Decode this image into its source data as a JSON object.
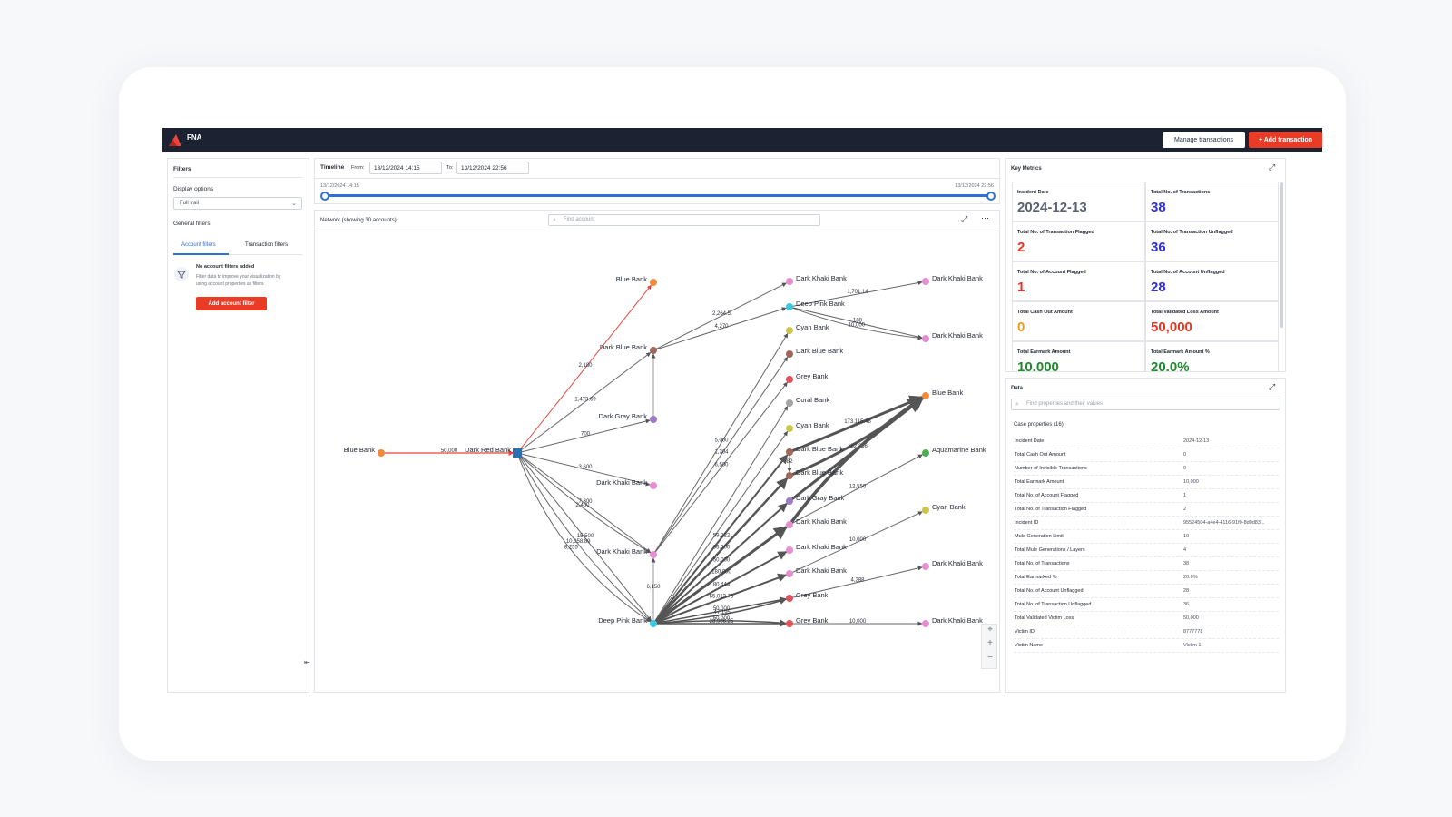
{
  "app": {
    "title": "FNA"
  },
  "header": {
    "manage_label": "Manage transactions",
    "add_label": "+ Add transaction"
  },
  "filters": {
    "title": "Filters",
    "display_options_label": "Display options",
    "display_option_value": "Full trail",
    "general_filters_label": "General filters",
    "tabs": [
      "Account filters",
      "Transaction filters"
    ],
    "empty_title": "No account filters added",
    "empty_text_1": "Filter data to improve your visualization by",
    "empty_text_2": "using account properties as filters",
    "add_filter_label": "Add account filter"
  },
  "timeline": {
    "title": "Timeline",
    "from_label": "From:",
    "from_value": "13/12/2024 14:15",
    "to_label": "To:",
    "to_value": "13/12/2024 22:56",
    "range_start": "13/12/2024 14:15",
    "range_end": "13/12/2024 22:56"
  },
  "network": {
    "title": "Network (showing 30 accounts)",
    "search_placeholder": "Find account",
    "nodes": [
      {
        "id": "n1",
        "label": "Blue Bank",
        "color": "#f08a3c"
      },
      {
        "id": "n2",
        "label": "Dark Red Bank",
        "color": "#2f6fb0"
      },
      {
        "id": "n3",
        "label": "Blue Bank",
        "color": "#f08a3c"
      },
      {
        "id": "n4",
        "label": "Dark Blue Bank",
        "color": "#a0675c"
      },
      {
        "id": "n5",
        "label": "Dark Gray Bank",
        "color": "#9a7cc6"
      },
      {
        "id": "n6",
        "label": "Dark Khaki Bank",
        "color": "#e58fd0"
      },
      {
        "id": "n7",
        "label": "Dark Khaki Bank",
        "color": "#e58fd0"
      },
      {
        "id": "n8",
        "label": "Deep Pink Bank",
        "color": "#3cc7e0"
      },
      {
        "id": "n9",
        "label": "Dark Khaki Bank",
        "color": "#e58fd0"
      },
      {
        "id": "n10",
        "label": "Deep Pink Bank",
        "color": "#3cc7e0"
      },
      {
        "id": "n11",
        "label": "Cyan Bank",
        "color": "#c9c64a"
      },
      {
        "id": "n12",
        "label": "Dark Blue Bank",
        "color": "#a0675c"
      },
      {
        "id": "n13",
        "label": "Grey Bank",
        "color": "#e0525a"
      },
      {
        "id": "n14",
        "label": "Coral Bank",
        "color": "#a3a3a3"
      },
      {
        "id": "n15",
        "label": "Cyan Bank",
        "color": "#c9c64a"
      },
      {
        "id": "n16",
        "label": "Dark Blue Bank",
        "color": "#a0675c"
      },
      {
        "id": "n17",
        "label": "Dark Blue Bank",
        "color": "#a0675c"
      },
      {
        "id": "n18",
        "label": "Dark Gray Bank",
        "color": "#9a7cc6"
      },
      {
        "id": "n19",
        "label": "Dark Khaki Bank",
        "color": "#e58fd0"
      },
      {
        "id": "n20",
        "label": "Dark Khaki Bank",
        "color": "#e58fd0"
      },
      {
        "id": "n21",
        "label": "Dark Khaki Bank",
        "color": "#e58fd0"
      },
      {
        "id": "n22",
        "label": "Grey Bank",
        "color": "#e0525a"
      },
      {
        "id": "n23",
        "label": "Grey Bank",
        "color": "#e0525a"
      },
      {
        "id": "n24",
        "label": "Dark Khaki Bank",
        "color": "#e58fd0"
      },
      {
        "id": "n25",
        "label": "Dark Khaki Bank",
        "color": "#e58fd0"
      },
      {
        "id": "n26",
        "label": "Blue Bank",
        "color": "#f08a3c"
      },
      {
        "id": "n27",
        "label": "Aquamarine Bank",
        "color": "#4caf50"
      },
      {
        "id": "n28",
        "label": "Cyan Bank",
        "color": "#c9c64a"
      },
      {
        "id": "n29",
        "label": "Dark Khaki Bank",
        "color": "#e58fd0"
      },
      {
        "id": "n30",
        "label": "Dark Khaki Bank",
        "color": "#e58fd0"
      }
    ],
    "edges": [
      {
        "from": "n1",
        "to": "n2",
        "label": "50,000",
        "w": 1.2,
        "color": "#e8453c"
      },
      {
        "from": "n2",
        "to": "n3",
        "label": "2,180",
        "w": 1,
        "color": "#e8453c"
      },
      {
        "from": "n2",
        "to": "n4",
        "label": "1,473.69",
        "w": 1,
        "color": "#666"
      },
      {
        "from": "n2",
        "to": "n5",
        "label": "700",
        "w": 1,
        "color": "#666"
      },
      {
        "from": "n2",
        "to": "n6",
        "label": "3,600",
        "w": 1,
        "color": "#666"
      },
      {
        "from": "n2",
        "to": "n7",
        "label": "7,300",
        "w": 1,
        "color": "#666"
      },
      {
        "from": "n2",
        "to": "n7",
        "label": "2,400",
        "w": 1,
        "color": "#666",
        "curve": 10
      },
      {
        "from": "n2",
        "to": "n8",
        "label": "15,500",
        "w": 1,
        "color": "#666"
      },
      {
        "from": "n2",
        "to": "n8",
        "label": "10,058.89",
        "w": 1,
        "color": "#666",
        "curve": 20
      },
      {
        "from": "n2",
        "to": "n8",
        "label": "8,255",
        "w": 1,
        "color": "#666",
        "curve": 40
      },
      {
        "from": "n4",
        "to": "n9",
        "label": "2,264.5",
        "w": 1,
        "color": "#666"
      },
      {
        "from": "n4",
        "to": "n10",
        "label": "4,270",
        "w": 1,
        "color": "#666"
      },
      {
        "from": "n10",
        "to": "n29",
        "label": "1,701.14",
        "w": 1,
        "color": "#666"
      },
      {
        "from": "n10",
        "to": "n30",
        "label": "188",
        "w": 1,
        "color": "#666"
      },
      {
        "from": "n10",
        "to": "n30",
        "label": "10,000",
        "w": 1,
        "color": "#666",
        "curve": 10
      },
      {
        "from": "n5",
        "to": "n4",
        "label": "",
        "w": 1,
        "color": "#999"
      },
      {
        "from": "n8",
        "to": "n7",
        "label": "6,150",
        "w": 1,
        "color": "#999"
      },
      {
        "from": "n7",
        "to": "n12",
        "label": "1,304",
        "w": 1,
        "color": "#666"
      },
      {
        "from": "n7",
        "to": "n11",
        "label": "5,000",
        "w": 1,
        "color": "#666"
      },
      {
        "from": "n7",
        "to": "n13",
        "label": "6,500",
        "w": 1,
        "color": "#666"
      },
      {
        "from": "n8",
        "to": "n14",
        "label": "",
        "w": 1,
        "color": "#666"
      },
      {
        "from": "n8",
        "to": "n15",
        "label": "",
        "w": 1,
        "color": "#666"
      },
      {
        "from": "n8",
        "to": "n16",
        "label": "59,222",
        "w": 2,
        "color": "#555"
      },
      {
        "from": "n8",
        "to": "n17",
        "label": "96,000",
        "w": 2.5,
        "color": "#555"
      },
      {
        "from": "n8",
        "to": "n18",
        "label": "50,000",
        "w": 2,
        "color": "#555"
      },
      {
        "from": "n8",
        "to": "n19",
        "label": "180,000",
        "w": 3,
        "color": "#555"
      },
      {
        "from": "n8",
        "to": "n20",
        "label": "80,444",
        "w": 2,
        "color": "#555"
      },
      {
        "from": "n8",
        "to": "n21",
        "label": "65,013.75",
        "w": 2,
        "color": "#555"
      },
      {
        "from": "n8",
        "to": "n22",
        "label": "50,000",
        "w": 1.5,
        "color": "#555"
      },
      {
        "from": "n8",
        "to": "n22",
        "label": "47,195",
        "w": 1.5,
        "color": "#555",
        "curve": 8
      },
      {
        "from": "n8",
        "to": "n23",
        "label": "50,000",
        "w": 1.5,
        "color": "#555",
        "curve": -6
      },
      {
        "from": "n8",
        "to": "n23",
        "label": "28,986.25",
        "w": 1.5,
        "color": "#555"
      },
      {
        "from": "n16",
        "to": "n26",
        "label": "173,115.48",
        "w": 3,
        "color": "#555"
      },
      {
        "from": "n17",
        "to": "n26",
        "label": "",
        "w": 3,
        "color": "#555",
        "curve": 12
      },
      {
        "from": "n18",
        "to": "n26",
        "label": "182,256",
        "w": 3,
        "color": "#555"
      },
      {
        "from": "n19",
        "to": "n26",
        "label": "",
        "w": 3.5,
        "color": "#555",
        "curve": -18
      },
      {
        "from": "n16",
        "to": "n17",
        "label": "82",
        "w": 1,
        "color": "#666"
      },
      {
        "from": "n19",
        "to": "n27",
        "label": "12,550",
        "w": 1,
        "color": "#666"
      },
      {
        "from": "n21",
        "to": "n28",
        "label": "10,000",
        "w": 1,
        "color": "#666"
      },
      {
        "from": "n22",
        "to": "n24",
        "label": "4,288",
        "w": 1,
        "color": "#666"
      },
      {
        "from": "n23",
        "to": "n25",
        "label": "10,000",
        "w": 1,
        "color": "#666"
      }
    ]
  },
  "metrics": {
    "title": "Key Metrics",
    "items": [
      {
        "label": "Incident Date",
        "value": "2024-12-13",
        "color": "#5a6170"
      },
      {
        "label": "Total No. of Transactions",
        "value": "38",
        "color": "#2d2fd9"
      },
      {
        "label": "Total No. of Transaction Flagged",
        "value": "2",
        "color": "#e53526"
      },
      {
        "label": "Total No. of Transaction Unflagged",
        "value": "36",
        "color": "#2d2fd9"
      },
      {
        "label": "Total No. of Account Flagged",
        "value": "1",
        "color": "#e53526"
      },
      {
        "label": "Total No. of Account Unflagged",
        "value": "28",
        "color": "#2d2fd9"
      },
      {
        "label": "Total Cash Out Amount",
        "value": "0",
        "color": "#f39c12"
      },
      {
        "label": "Total Validated Loss Amount",
        "value": "50,000",
        "color": "#e53526"
      },
      {
        "label": "Total Earmark Amount",
        "value": "10,000",
        "color": "#1f8a2e"
      },
      {
        "label": "Total Earmark Amount %",
        "value": "20.0%",
        "color": "#1f8a2e"
      }
    ]
  },
  "data_panel": {
    "title": "Data",
    "search_placeholder": "Find properties and their values",
    "section_label": "Case properties (16)",
    "rows": [
      {
        "key": "Incident Date",
        "value": "2024-12-13"
      },
      {
        "key": "Total Cash Out Amount",
        "value": "0"
      },
      {
        "key": "Number of Invisible Transactions",
        "value": "0"
      },
      {
        "key": "Total Earmark Amount",
        "value": "10,000"
      },
      {
        "key": "Total No. of Account Flagged",
        "value": "1"
      },
      {
        "key": "Total No. of Transaction Flagged",
        "value": "2"
      },
      {
        "key": "Incident ID",
        "value": "95524504-a4e4-4116-91f0-8d0d83..."
      },
      {
        "key": "Mule Generation Limit",
        "value": "10"
      },
      {
        "key": "Total Mule Generations / Layers",
        "value": "4"
      },
      {
        "key": "Total No. of Transactions",
        "value": "38"
      },
      {
        "key": "Total Earmarked %",
        "value": "20.0%"
      },
      {
        "key": "Total No. of Account Unflagged",
        "value": "28"
      },
      {
        "key": "Total No. of Transaction Unflagged",
        "value": "36"
      },
      {
        "key": "Total Validated Victim Loss",
        "value": "50,000"
      },
      {
        "key": "Victim ID",
        "value": "8777778"
      },
      {
        "key": "Victim Name",
        "value": "Victim 1"
      }
    ]
  }
}
